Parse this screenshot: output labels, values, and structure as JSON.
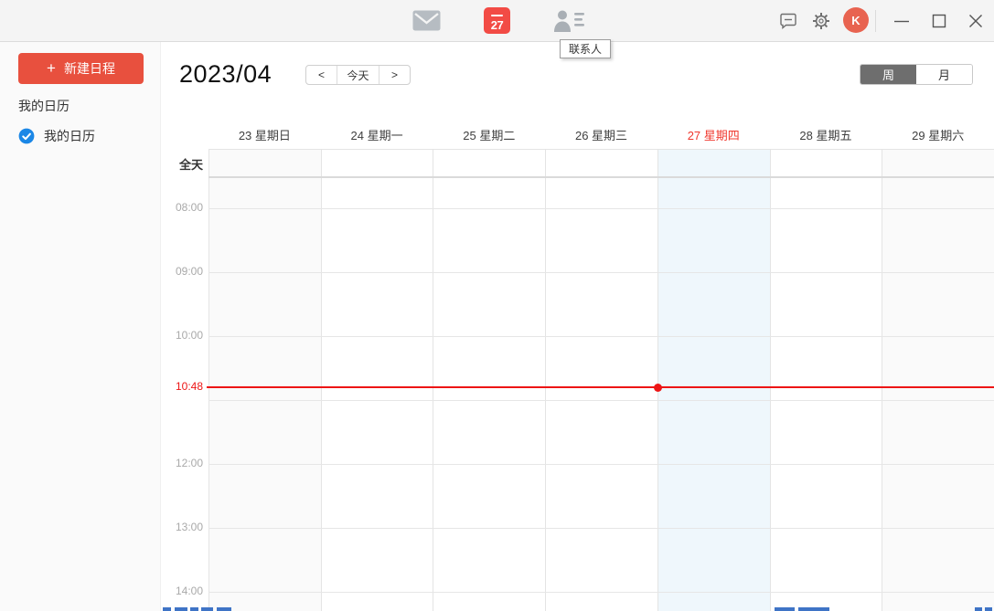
{
  "topbar": {
    "calendar_badge": "27",
    "contacts_tooltip": "联系人",
    "avatar_initial": "K"
  },
  "toolbar": {
    "title": "2023/04",
    "prev_label": "<",
    "today_label": "今天",
    "next_label": ">",
    "week_label": "周",
    "month_label": "月",
    "active_view": "周"
  },
  "sidebar": {
    "plus": "+",
    "new_event_label": "新建日程",
    "section_title": "我的日历",
    "calendars": [
      {
        "label": "我的日历",
        "checked": true
      }
    ]
  },
  "calendar": {
    "all_day_label": "全天",
    "days": [
      {
        "label": "23 星期日",
        "weekend": true,
        "today": false
      },
      {
        "label": "24 星期一",
        "weekend": false,
        "today": false
      },
      {
        "label": "25 星期二",
        "weekend": false,
        "today": false
      },
      {
        "label": "26 星期三",
        "weekend": false,
        "today": false
      },
      {
        "label": "27 星期四",
        "weekend": false,
        "today": true
      },
      {
        "label": "28 星期五",
        "weekend": false,
        "today": false
      },
      {
        "label": "29 星期六",
        "weekend": true,
        "today": false
      }
    ],
    "hour_labels": [
      "08:00",
      "09:00",
      "10:00",
      "12:00",
      "13:00",
      "14:00"
    ],
    "now_label": "10:48"
  },
  "colors": {
    "primary_red": "#e8503e",
    "calendar_icon_red": "#f24b45",
    "today_text_red": "#f0382e",
    "now_line_red": "#ed1515",
    "check_blue": "#1b87e6",
    "today_column_bg": "#eff7fc",
    "weekend_column_bg": "#fafafa",
    "active_toggle_bg": "#6e6e6e",
    "topbar_bg": "#f4f4f4"
  }
}
